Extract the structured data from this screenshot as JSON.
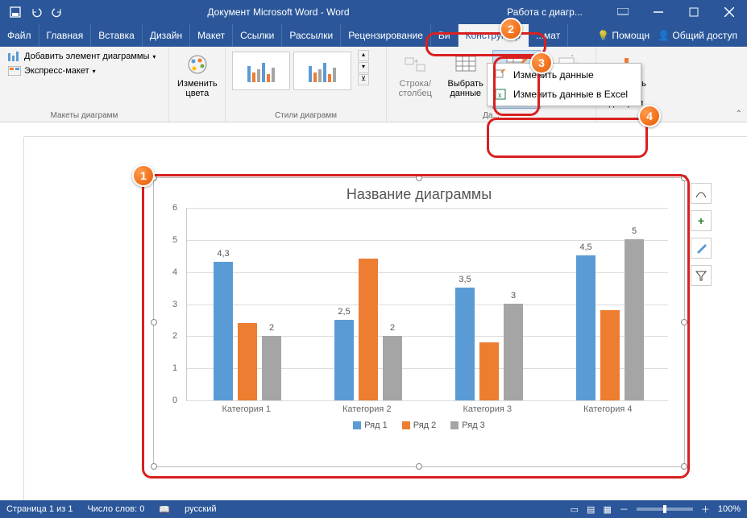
{
  "app": {
    "title": "Документ Microsoft Word - Word",
    "context_title": "Работа с диагр..."
  },
  "tabs": {
    "file": "Файл",
    "list": [
      "Главная",
      "Вставка",
      "Дизайн",
      "Макет",
      "Ссылки",
      "Рассылки",
      "Рецензирование",
      "Ви"
    ],
    "context": [
      "Конструктор",
      "...мат"
    ],
    "help": "Помощн",
    "share": "Общий доступ"
  },
  "ribbon": {
    "layouts": {
      "add_element": "Добавить элемент диаграммы",
      "quick_layout": "Экспресс-макет",
      "group_label": "Макеты диаграмм"
    },
    "colors_btn": "Изменить цвета",
    "styles_group": "Стили диаграмм",
    "data": {
      "switch": "Строка/\nстолбец",
      "select": "Выбрать\nданные",
      "edit": "Изменить\nданные",
      "refresh": "Обновить\nданные",
      "group_label": "Да..."
    },
    "type": {
      "change": "Изменить т\nдиаграм"
    },
    "dropdown": {
      "edit_data": "Изменить данные",
      "edit_excel": "Изменить данные в Excel"
    }
  },
  "callouts": {
    "c1": "1",
    "c2": "2",
    "c3": "3",
    "c4": "4"
  },
  "chart_data": {
    "type": "bar",
    "title": "Название диаграммы",
    "categories": [
      "Категория 1",
      "Категория 2",
      "Категория 3",
      "Категория 4"
    ],
    "series": [
      {
        "name": "Ряд 1",
        "color": "#5b9bd5",
        "values": [
          4.3,
          2.5,
          3.5,
          4.5
        ]
      },
      {
        "name": "Ряд 2",
        "color": "#ed7d31",
        "values": [
          2.4,
          4.4,
          1.8,
          2.8
        ]
      },
      {
        "name": "Ряд 3",
        "color": "#a5a5a5",
        "values": [
          2,
          2,
          3,
          5
        ]
      }
    ],
    "data_labels": {
      "0": {
        "0": "4,3",
        "2": "2"
      },
      "1": {
        "0": "2,5",
        "2": "2"
      },
      "2": {
        "0": "3,5",
        "2": "3"
      },
      "3": {
        "0": "4,5",
        "2": "5"
      }
    },
    "xlabel": "",
    "ylabel": "",
    "ylim": [
      0,
      6
    ],
    "yticks": [
      0,
      1,
      2,
      3,
      4,
      5,
      6
    ]
  },
  "status": {
    "page": "Страница 1 из 1",
    "words": "Число слов: 0",
    "lang": "русский",
    "zoom": "100%"
  }
}
